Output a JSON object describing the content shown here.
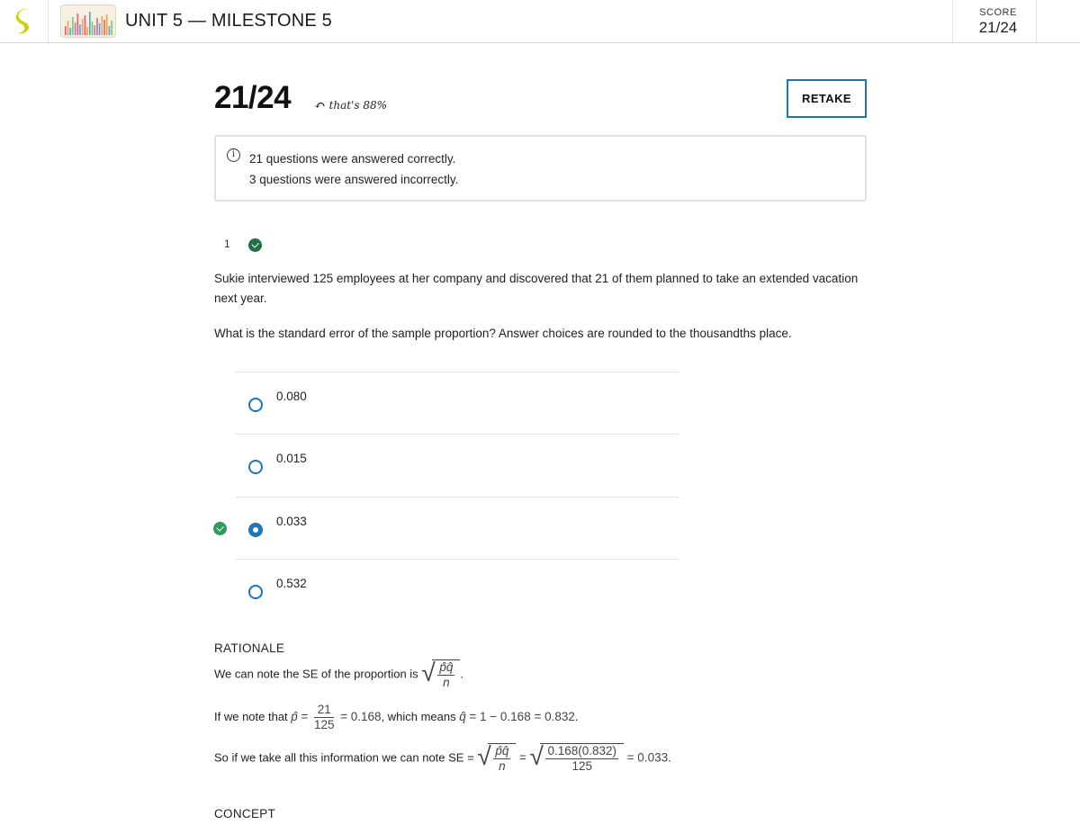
{
  "header": {
    "title": "UNIT 5 — MILESTONE 5",
    "score_label": "SCORE",
    "score_value": "21/24",
    "brand_color": "#c8d400"
  },
  "summary": {
    "score": "21/24",
    "percent_note": "that's 88%",
    "retake_label": "RETAKE",
    "accent_color": "#1c76b8",
    "correct_text": "21 questions were answered correctly.",
    "incorrect_text": "3 questions were answered incorrectly."
  },
  "question": {
    "number": "1",
    "status": "correct",
    "text": "Sukie interviewed 125 employees at her company and discovered that 21 of them planned to take an extended vacation next year.",
    "prompt": "What is the standard error of the sample proportion?  Answer choices are rounded to the thousandths place.",
    "choices": [
      {
        "label": "0.080",
        "selected": false,
        "correct": false
      },
      {
        "label": "0.015",
        "selected": false,
        "correct": false
      },
      {
        "label": "0.033",
        "selected": true,
        "correct": true
      },
      {
        "label": "0.532",
        "selected": false,
        "correct": false
      }
    ]
  },
  "rationale": {
    "title": "RATIONALE",
    "line1_text": "We can note the SE of the proportion is",
    "line2_text_a": "If we note that",
    "line2_text_b": ", which means",
    "line3_text": "So if we take all this information we can note SE =",
    "p_hat": "p̂",
    "q_hat": "q̂",
    "pq": "p̂q̂",
    "n": "n",
    "num_21": "21",
    "den_125": "125",
    "eq_0168": "= 0.168",
    "q_calc": "= 1 − 0.168  =  0.832",
    "se_num": "0.168(0.832)",
    "se_den": "125",
    "se_result": "= 0.033",
    "eq": "=",
    "period": "."
  },
  "concept": {
    "title": "CONCEPT"
  },
  "colors": {
    "correct_green": "#2e9b5a",
    "divider": "#e3e3e3"
  }
}
